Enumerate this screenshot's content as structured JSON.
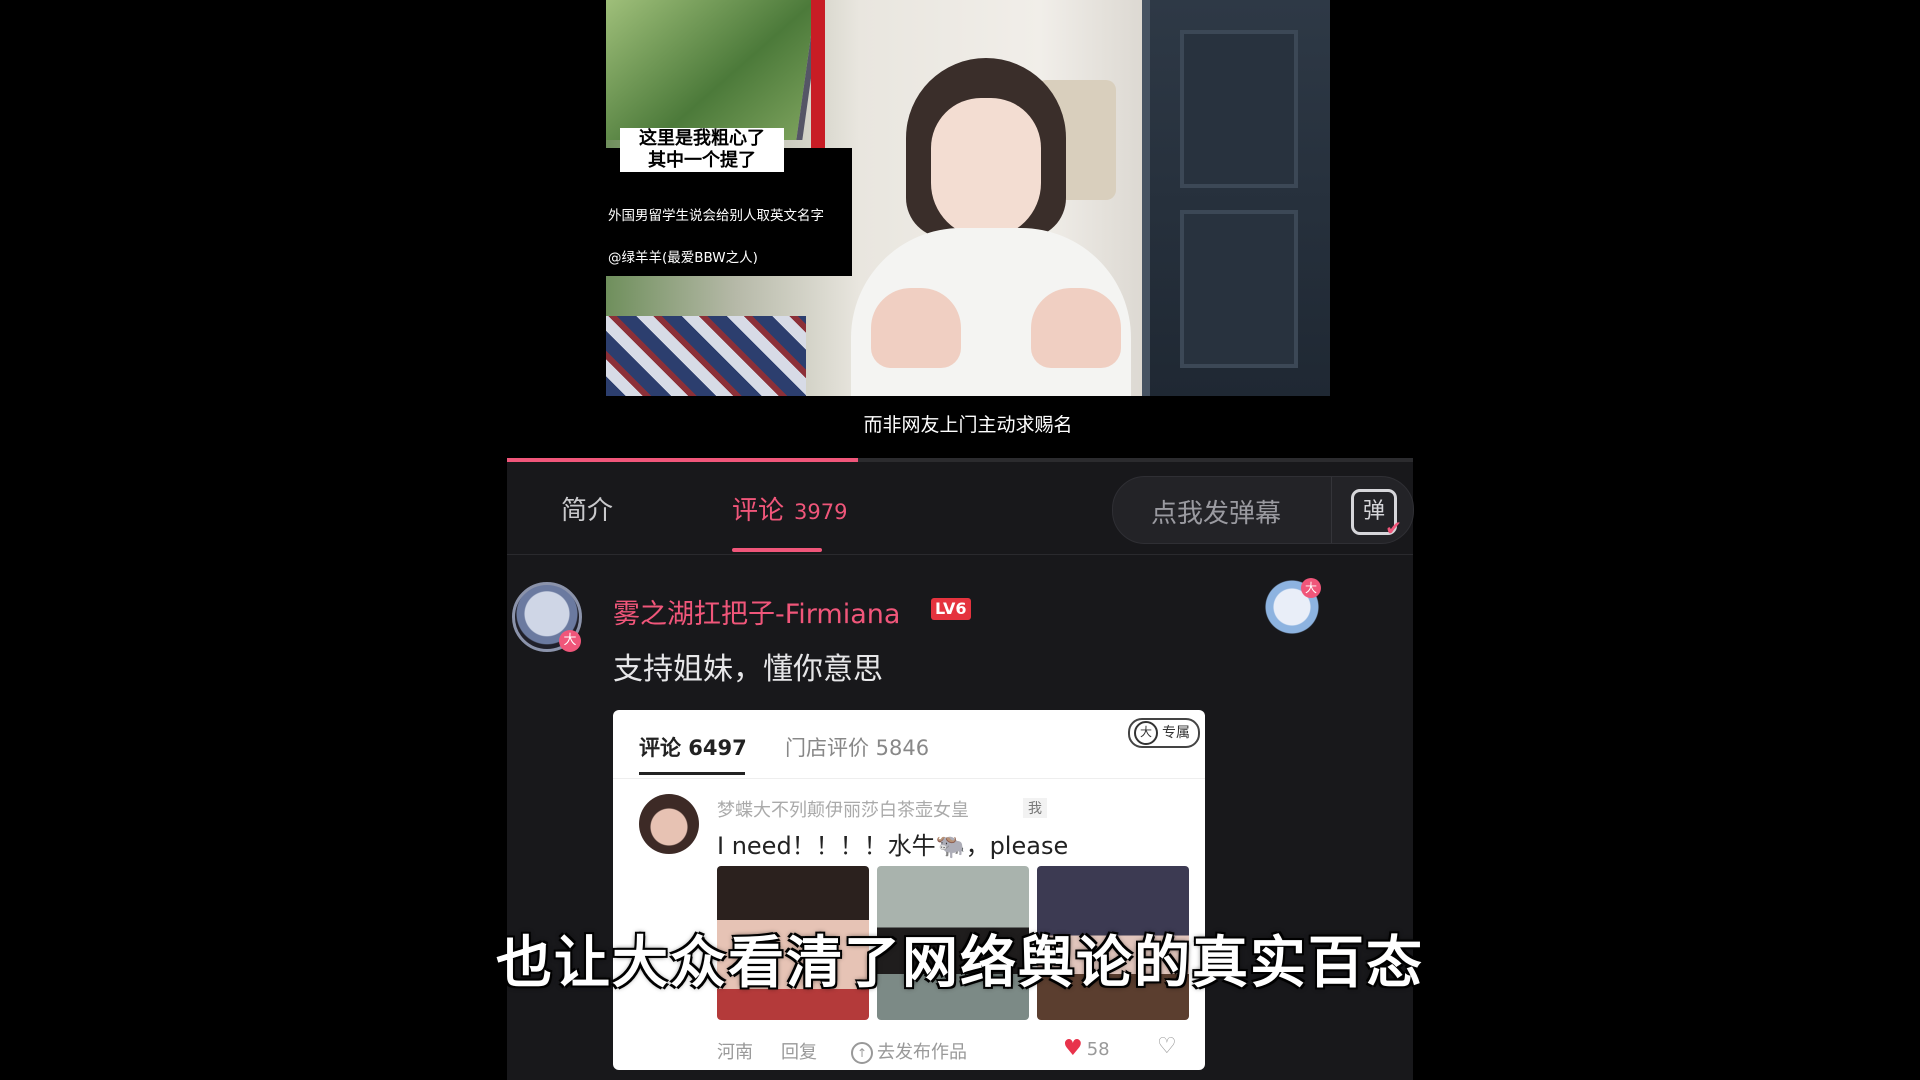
{
  "video": {
    "caption_top": "这里是我粗心了\n其中一个提了",
    "overlay_lines": [
      "外国男留学生说会给别人取英文名字",
      "@绿羊羊(最爱BBW之人)"
    ],
    "subtitle": "而非网友上门主动求赐名",
    "progress": 0.387
  },
  "tabs": {
    "intro": "简介",
    "comments": "评论",
    "comments_count": "3979"
  },
  "danmaku": {
    "placeholder": "点我发弹幕",
    "icon": "弹"
  },
  "comment": {
    "username": "雾之湖扛把子-Firmiana",
    "level": "LV6",
    "text": "支持姐妹，懂你意思",
    "avatar_badge": "大",
    "sticker_badge": "大"
  },
  "embed": {
    "tab_comments": "评论 6497",
    "tab_reviews": "门店评价 5846",
    "exclusive_icon": "大",
    "exclusive": "专属",
    "username": "梦蝶大不列颠伊丽莎白茶壶女皇",
    "me_tag": "我",
    "comment": "I need！！！！水牛🐃，please",
    "location": "河南",
    "reply": "回复",
    "publish": "去发布作品",
    "likes": "58"
  },
  "overlay_subtitle": "也让大众看清了网络舆论的真实百态",
  "colors": {
    "accent": "#f0567a",
    "panel_bg": "#18181b",
    "level_badge": "#e5333e"
  }
}
